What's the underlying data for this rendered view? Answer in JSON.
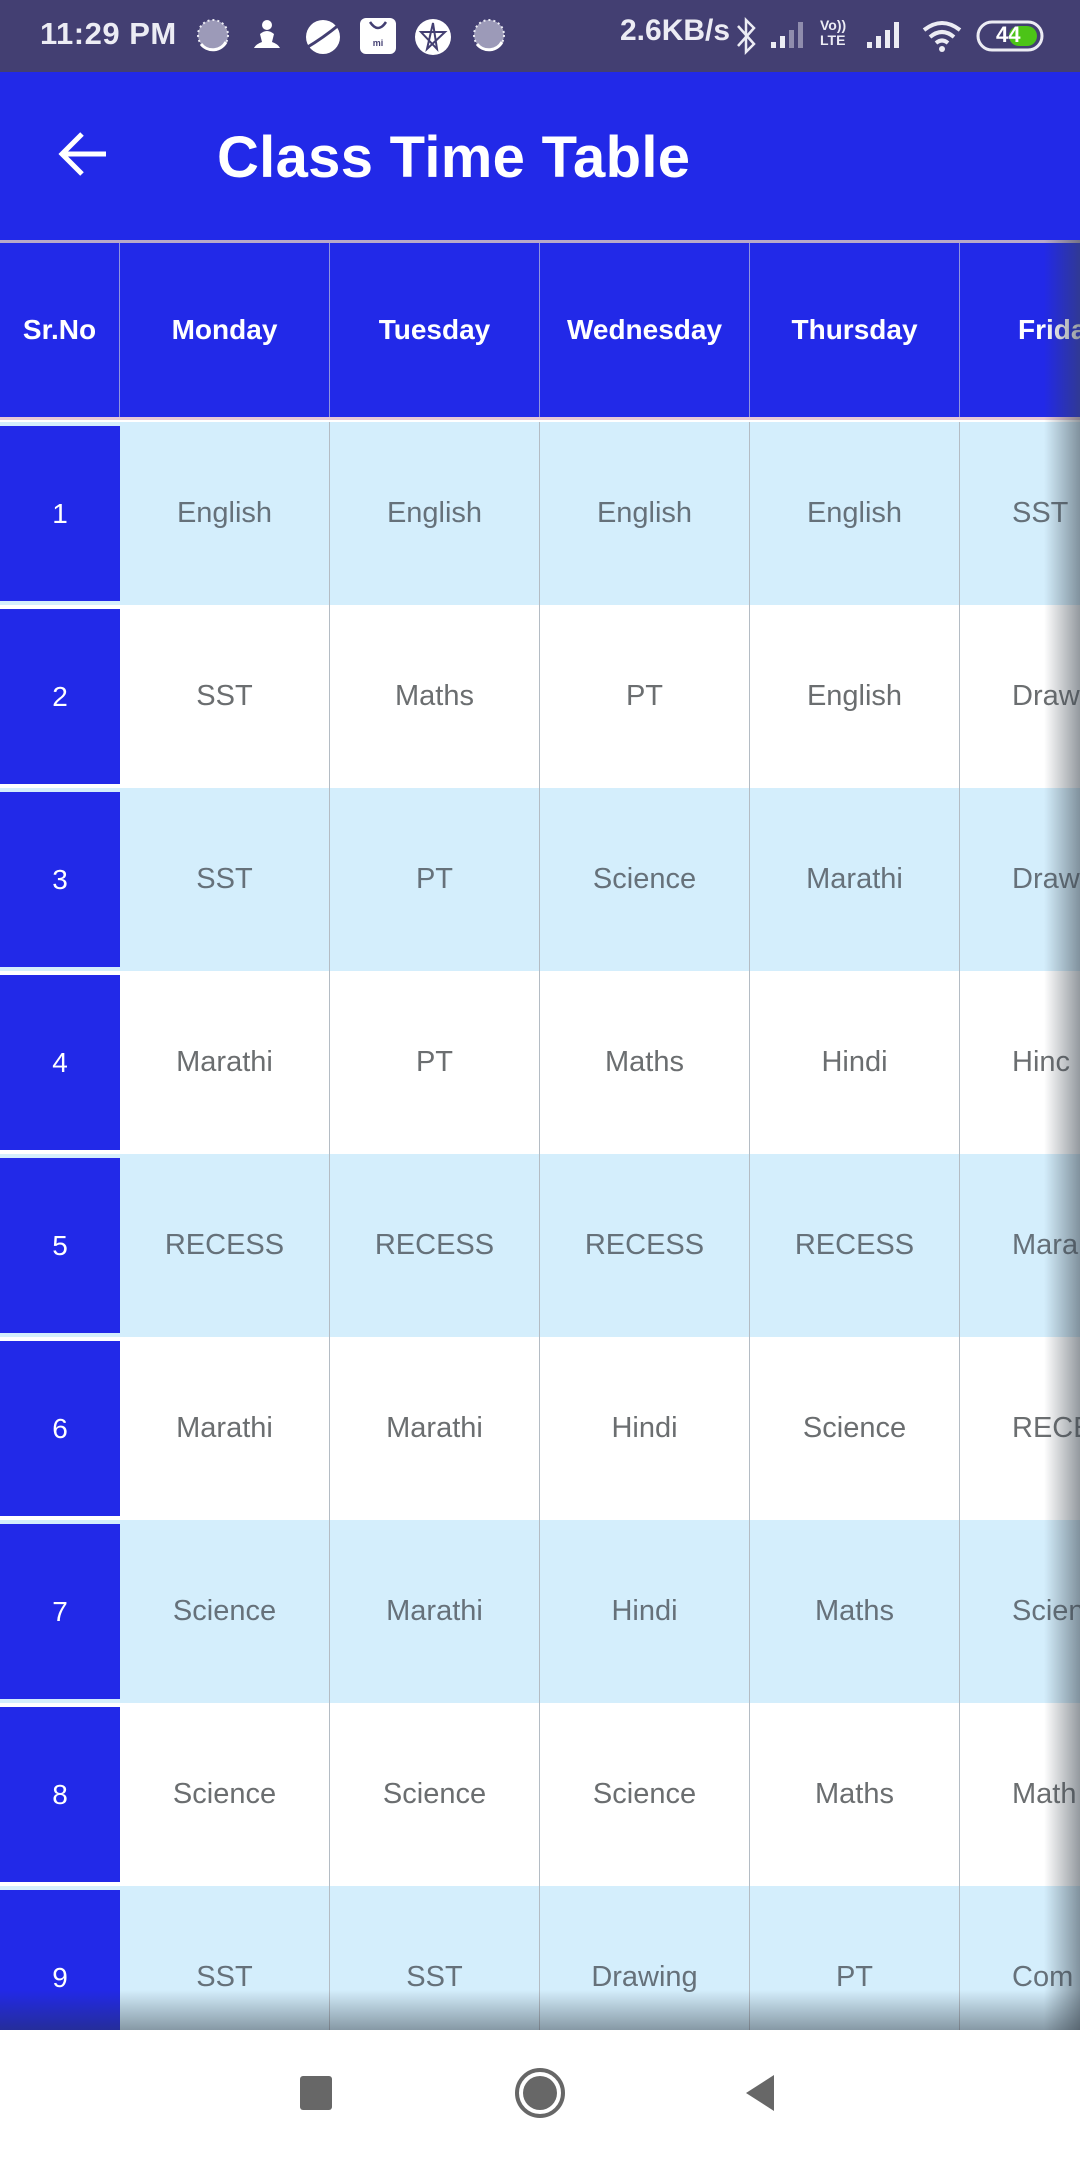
{
  "status_bar": {
    "time": "11:29 PM",
    "network_speed": "2.6KB/s",
    "battery_level": "44",
    "volte_label_top": "Vo))",
    "volte_label_bottom": "LTE",
    "notification_icons": [
      "loading-circle-icon",
      "meditation-app-icon",
      "browser-planet-icon",
      "mi-store-icon",
      "star-app-icon",
      "loading-circle-icon"
    ],
    "system_icons": [
      "bluetooth-icon",
      "signal-weak-icon",
      "volte-icon",
      "signal-strong-icon",
      "wifi-icon",
      "battery-icon"
    ],
    "colors": {
      "background": "#433F72",
      "battery_fill": "#4CC417"
    }
  },
  "app_bar": {
    "title": "Class Time Table",
    "back_icon": "arrow-left-icon",
    "color": "#2229E8"
  },
  "table": {
    "columns": [
      "Sr.No",
      "Monday",
      "Tuesday",
      "Wednesday",
      "Thursday",
      "Frida"
    ],
    "rows": [
      {
        "srno": "1",
        "cells": [
          "English",
          "English",
          "English",
          "English",
          "SST"
        ]
      },
      {
        "srno": "2",
        "cells": [
          "SST",
          "Maths",
          "PT",
          "English",
          "Drawi"
        ]
      },
      {
        "srno": "3",
        "cells": [
          "SST",
          "PT",
          "Science",
          "Marathi",
          "Drawi"
        ]
      },
      {
        "srno": "4",
        "cells": [
          "Marathi",
          "PT",
          "Maths",
          "Hindi",
          "Hinc"
        ]
      },
      {
        "srno": "5",
        "cells": [
          "RECESS",
          "RECESS",
          "RECESS",
          "RECESS",
          "Mara"
        ]
      },
      {
        "srno": "6",
        "cells": [
          "Marathi",
          "Marathi",
          "Hindi",
          "Science",
          "RECE"
        ]
      },
      {
        "srno": "7",
        "cells": [
          "Science",
          "Marathi",
          "Hindi",
          "Maths",
          "Scien"
        ]
      },
      {
        "srno": "8",
        "cells": [
          "Science",
          "Science",
          "Science",
          "Maths",
          "Math"
        ]
      },
      {
        "srno": "9",
        "cells": [
          "SST",
          "SST",
          "Drawing",
          "PT",
          "Com"
        ]
      }
    ],
    "colors": {
      "header": "#2229E8",
      "row_alt": "#D4EEFC",
      "row_plain": "#FFFFFF",
      "cell_text": "#66717A"
    }
  },
  "nav_bar": {
    "buttons": [
      "recents-square-icon",
      "home-circle-icon",
      "back-triangle-icon"
    ]
  }
}
